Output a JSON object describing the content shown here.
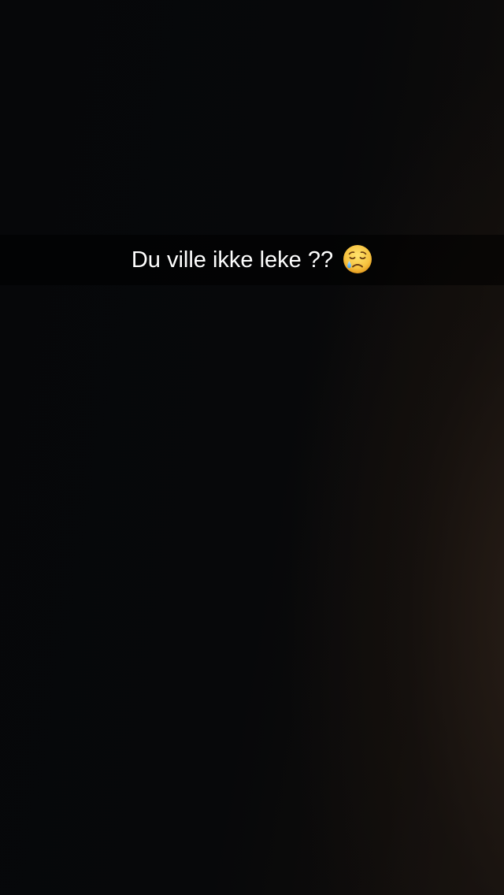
{
  "snap": {
    "caption": "Du ville ikke leke ??",
    "emoji": "sad-but-relieved-face-icon"
  }
}
